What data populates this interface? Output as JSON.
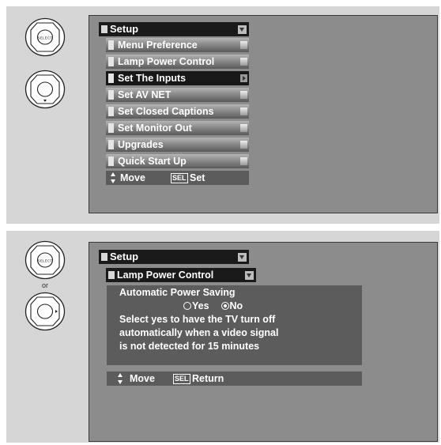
{
  "top": {
    "remote_select_label": "SELECT",
    "menu_title": "Setup",
    "items": [
      {
        "label": "Menu Preference",
        "selected": false
      },
      {
        "label": "Lamp Power Control",
        "selected": false
      },
      {
        "label": "Set The Inputs",
        "selected": true
      },
      {
        "label": "Set AV NET",
        "selected": false
      },
      {
        "label": "Set Closed Captions",
        "selected": false
      },
      {
        "label": "Set Monitor Out",
        "selected": false
      },
      {
        "label": "Upgrades",
        "selected": false
      },
      {
        "label": "Quick Start Up",
        "selected": false
      }
    ],
    "hint_move": "Move",
    "hint_sel": "SEL",
    "hint_action": "Set"
  },
  "bottom": {
    "remote_select_label": "SELECT",
    "or_label": "or",
    "menu_title": "Setup",
    "submenu_title": "Lamp Power Control",
    "setting_name": "Automatic Power Saving",
    "option_yes": "Yes",
    "option_no": "No",
    "selected_option": "No",
    "description_lines": [
      "Select yes to have the TV turn off",
      "automatically when a video signal",
      "is not detected for 15 minutes"
    ],
    "hint_move": "Move",
    "hint_sel": "SEL",
    "hint_action": "Return"
  },
  "colors": {
    "panel_bg": "#d6d6d6",
    "screen_bg": "#8c8c8c",
    "menu_dark": "#1a1a1a",
    "info_bg": "#5c5c5c"
  },
  "icons": [
    "select-button-icon",
    "dpad-down-icon",
    "dpad-right-icon",
    "up-down-arrow-icon",
    "radio-icon"
  ]
}
